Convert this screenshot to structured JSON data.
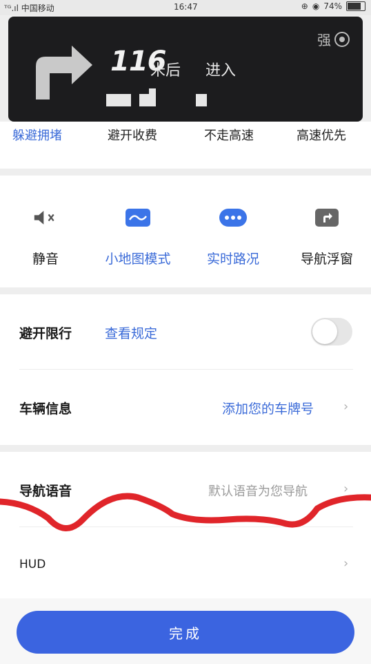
{
  "status_bar": {
    "carrier": "ᵀᴳ.ıl 中国移动",
    "time": "16:47",
    "battery": "74%"
  },
  "nav_card": {
    "distance": "116",
    "after_text": "米后",
    "action_text": "进入",
    "signal_label": "强"
  },
  "route_prefs": [
    "躲避拥堵",
    "避开收费",
    "不走高速",
    "高速优先"
  ],
  "quick_actions": [
    {
      "label": "静音",
      "icon": "mute-icon"
    },
    {
      "label": "小地图模式",
      "icon": "minimap-icon"
    },
    {
      "label": "实时路况",
      "icon": "traffic-icon"
    },
    {
      "label": "导航浮窗",
      "icon": "float-window-icon"
    }
  ],
  "restrictions": {
    "avoid_label": "避开限行",
    "view_rules": "查看规定",
    "avoid_enabled": false,
    "vehicle_label": "车辆信息",
    "vehicle_hint": "添加您的车牌号"
  },
  "voice": {
    "label": "导航语音",
    "hint": "默认语音为您导航"
  },
  "hud": {
    "label": "HUD"
  },
  "done_label": "完成",
  "colors": {
    "accent": "#3b64e0",
    "link": "#3b6bd8",
    "overlay": "#1c1c1e",
    "scribble": "#e0252a"
  }
}
